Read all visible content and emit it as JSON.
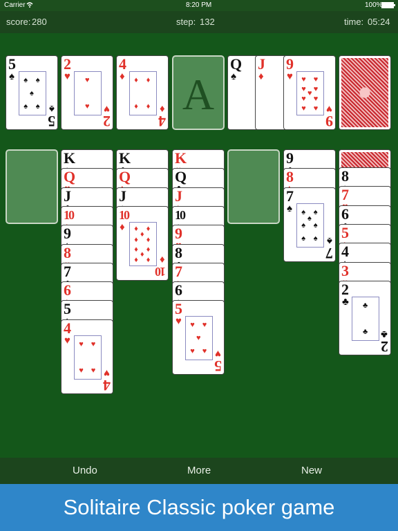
{
  "status_bar": {
    "carrier": "Carrier",
    "time": "8:20 PM",
    "battery": "100%",
    "wifi_icon": "wifi-icon",
    "battery_icon": "battery-icon"
  },
  "info_bar": {
    "score_label": "score:",
    "score_value": "280",
    "step_label": "step:",
    "step_value": "132",
    "time_label": "time:",
    "time_value": "05:24"
  },
  "foundations": [
    {
      "rank": "5",
      "suit": "♠",
      "color": "black"
    },
    {
      "rank": "2",
      "suit": "♥",
      "color": "red"
    },
    {
      "rank": "4",
      "suit": "♦",
      "color": "red"
    },
    {
      "rank": "A",
      "empty": true
    }
  ],
  "waste": [
    {
      "rank": "Q",
      "suit": "♠",
      "color": "black"
    },
    {
      "rank": "J",
      "suit": "♦",
      "color": "red"
    },
    {
      "rank": "9",
      "suit": "♥",
      "color": "red"
    }
  ],
  "stock_back": "card-back",
  "tableau": [
    {
      "column": 1,
      "empty": true,
      "cards": []
    },
    {
      "column": 2,
      "cards": [
        {
          "rank": "K",
          "suit": "♠",
          "color": "black"
        },
        {
          "rank": "Q",
          "suit": "♥",
          "color": "red"
        },
        {
          "rank": "J",
          "suit": "♣",
          "color": "black"
        },
        {
          "rank": "10",
          "suit": "♦",
          "color": "red"
        },
        {
          "rank": "9",
          "suit": "♠",
          "color": "black"
        },
        {
          "rank": "8",
          "suit": "♥",
          "color": "red"
        },
        {
          "rank": "7",
          "suit": "♣",
          "color": "black"
        },
        {
          "rank": "6",
          "suit": "♦",
          "color": "red"
        },
        {
          "rank": "5",
          "suit": "♠",
          "color": "black"
        },
        {
          "rank": "4",
          "suit": "♥",
          "color": "red"
        }
      ]
    },
    {
      "column": 3,
      "cards": [
        {
          "rank": "K",
          "suit": "♣",
          "color": "black"
        },
        {
          "rank": "Q",
          "suit": "♦",
          "color": "red"
        },
        {
          "rank": "J",
          "suit": "♠",
          "color": "black"
        },
        {
          "rank": "10",
          "suit": "♦",
          "color": "red"
        }
      ]
    },
    {
      "column": 4,
      "cards": [
        {
          "rank": "K",
          "suit": "♥",
          "color": "red"
        },
        {
          "rank": "Q",
          "suit": "♣",
          "color": "black"
        },
        {
          "rank": "J",
          "suit": "♦",
          "color": "red"
        },
        {
          "rank": "10",
          "suit": "♠",
          "color": "black"
        },
        {
          "rank": "9",
          "suit": "♥",
          "color": "red"
        },
        {
          "rank": "8",
          "suit": "♣",
          "color": "black"
        },
        {
          "rank": "7",
          "suit": "♦",
          "color": "red"
        },
        {
          "rank": "6",
          "suit": "♠",
          "color": "black"
        },
        {
          "rank": "5",
          "suit": "♥",
          "color": "red"
        }
      ]
    },
    {
      "column": 5,
      "empty": true,
      "cards": []
    },
    {
      "column": 6,
      "cards": [
        {
          "rank": "9",
          "suit": "♣",
          "color": "black"
        },
        {
          "rank": "8",
          "suit": "♦",
          "color": "red"
        },
        {
          "rank": "7",
          "suit": "♠",
          "color": "black"
        }
      ]
    },
    {
      "column": 7,
      "cards": [
        {
          "back": true
        },
        {
          "rank": "8",
          "suit": "♠",
          "color": "black"
        },
        {
          "rank": "7",
          "suit": "♥",
          "color": "red"
        },
        {
          "rank": "6",
          "suit": "♣",
          "color": "black"
        },
        {
          "rank": "5",
          "suit": "♦",
          "color": "red"
        },
        {
          "rank": "4",
          "suit": "♠",
          "color": "black"
        },
        {
          "rank": "3",
          "suit": "♥",
          "color": "red"
        },
        {
          "rank": "2",
          "suit": "♣",
          "color": "black"
        }
      ]
    }
  ],
  "toolbar": {
    "undo_label": "Undo",
    "more_label": "More",
    "new_label": "New"
  },
  "banner": {
    "text": "Solitaire  Classic poker game"
  },
  "colors": {
    "felt": "#14571a",
    "bar": "#1c451d",
    "banner": "#2f86c9",
    "red_suit": "#e0312a"
  }
}
